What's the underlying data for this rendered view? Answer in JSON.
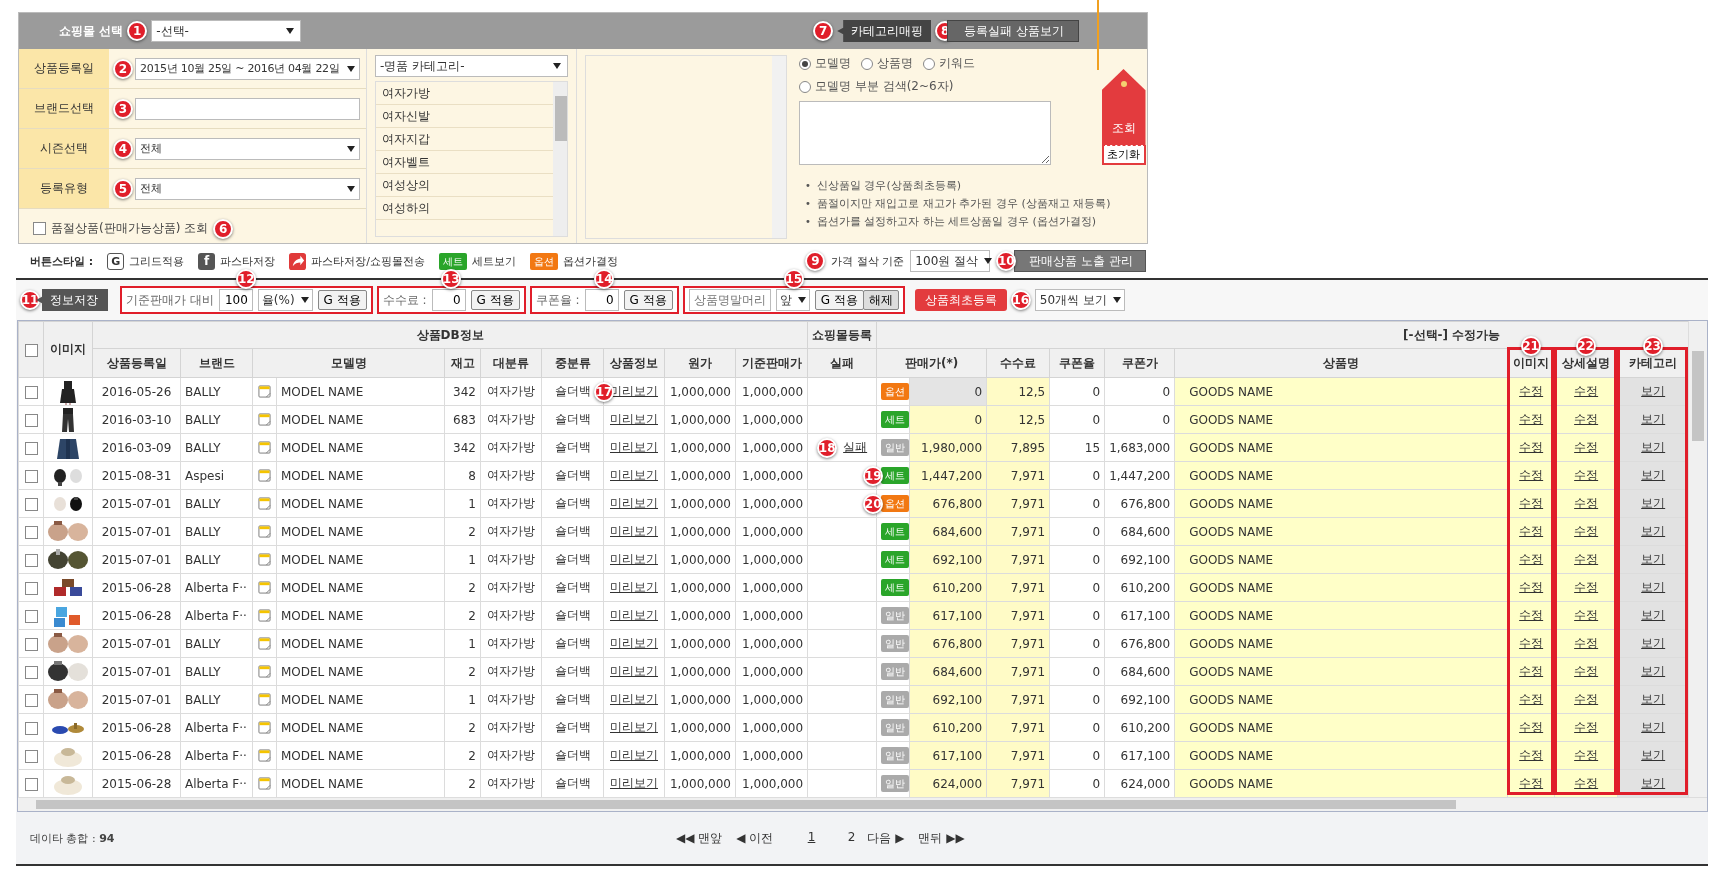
{
  "top_panel": {
    "shop_select": {
      "label": "쇼핑몰 선택",
      "marker": "1",
      "value": "-선택-"
    },
    "header_buttons": [
      {
        "marker": "7",
        "label": "카테고리매핑",
        "kind": "dark"
      },
      {
        "marker": "8",
        "label": "등록실패 상품보기",
        "kind": "grey"
      }
    ],
    "fields": [
      {
        "kind": "select",
        "label": "상품등록일",
        "marker": "2",
        "value": "2015년 10월 25일 ~ 2016년 04월 22일"
      },
      {
        "kind": "input",
        "label": "브랜드선택",
        "marker": "3"
      },
      {
        "kind": "select",
        "label": "시즌선택",
        "marker": "4",
        "value": "전체"
      },
      {
        "kind": "select",
        "label": "등록유형",
        "marker": "5",
        "value": "전체"
      }
    ],
    "soldout_check": {
      "label": "품절상품(판매가능상품) 조회",
      "checked": false,
      "marker": "6"
    },
    "category": {
      "value": "-명품 카테고리-",
      "items": [
        "여자가방",
        "여자신발",
        "여자지갑",
        "여자벨트",
        "여성상의",
        "여성하의"
      ]
    },
    "search_options": [
      {
        "label": "모델명",
        "selected": true
      },
      {
        "label": "상품명",
        "selected": false
      },
      {
        "label": "키워드",
        "selected": false
      },
      {
        "label": "모델명 부분 검색(2~6자)",
        "selected": false
      }
    ],
    "note_bullet": "•",
    "notes": [
      "신상품일 경우(상품최초등록)",
      "품절이지만 재입고로 재고가 추가된 경우 (상품재고 재등록)",
      "옵션가를 설정하고자 하는 세트상품일 경우 (옵션가결정)"
    ],
    "search_tag": {
      "label": "조회",
      "reset": "초기화"
    }
  },
  "button_styles": {
    "label": "버튼스타일 :",
    "items": [
      {
        "kind": "grid",
        "icon": "G",
        "label": "그리드적용"
      },
      {
        "kind": "save",
        "icon": "f",
        "label": "파스타저장"
      },
      {
        "kind": "send",
        "label": "파스타저장/쇼핑몰전송"
      },
      {
        "kind": "set",
        "icon": "세트",
        "label": "세트보기"
      },
      {
        "kind": "option",
        "icon": "옵션",
        "label": "옵션가결정"
      }
    ],
    "rounding": {
      "marker": "9",
      "label": "가격 절삭 기준",
      "value": "100원 절삭"
    },
    "exposure_button": {
      "marker": "10",
      "label": "판매상품 노출 관리"
    }
  },
  "toolbar": {
    "save_button": {
      "marker": "11",
      "label": "정보저장"
    },
    "groups": [
      {
        "marker": "12",
        "label": "기준판매가 대비",
        "value": "100",
        "unit": "율(%)",
        "apply": "G 적용"
      },
      {
        "marker": "13",
        "label": "수수료 :",
        "value": "0",
        "apply": "G 적용"
      },
      {
        "marker": "14",
        "label": "쿠폰율 :",
        "value": "0",
        "apply": "G 적용"
      },
      {
        "marker": "15",
        "placeholder": "상품명말머리",
        "unit": "앞",
        "apply": "G 적용",
        "clear": "해제"
      }
    ],
    "register_button": {
      "label": "상품최초등록",
      "marker": "16"
    },
    "page_size": "50개씩 보기"
  },
  "table": {
    "select_all": {
      "checked": false
    },
    "group_headers": [
      "상품DB정보",
      "쇼핑몰등록",
      "[-선택-] 수정가능"
    ],
    "columns": [
      {
        "label": "이미지"
      },
      {
        "label": "상품등록일"
      },
      {
        "label": "브랜드"
      },
      {
        "label": "모델명"
      },
      {
        "label": "재고"
      },
      {
        "label": "대분류"
      },
      {
        "label": "중분류"
      },
      {
        "label": "상품정보"
      },
      {
        "label": "원가"
      },
      {
        "label": "기준판매가"
      },
      {
        "label": "실패"
      },
      {
        "label": "판매가(*)"
      },
      {
        "label": "수수료"
      },
      {
        "label": "쿠폰율"
      },
      {
        "label": "쿠폰가"
      },
      {
        "label": "상품명"
      },
      {
        "label": "이미지",
        "marker": "21"
      },
      {
        "label": "상세설명",
        "marker": "22"
      },
      {
        "label": "카테고리",
        "marker": "23"
      }
    ],
    "rows": [
      {
        "checked": false,
        "date": "2016-05-26",
        "brand": "BALLY",
        "model": "MODEL NAME",
        "stock": "342",
        "cat1": "여자가방",
        "cat2": "숄더백",
        "info": "미리보기",
        "cost": "1,000,000",
        "base": "1,000,000",
        "badge": {
          "kind": "option",
          "label": "옵션"
        },
        "price": "0",
        "price_disabled": true,
        "fee": "12,5",
        "coupon_rate": "0",
        "coupon_price": "0",
        "name": "GOODS NAME",
        "image_edit": "수정",
        "desc_edit": "수정",
        "category_view": "보기",
        "info_marker": "17"
      },
      {
        "checked": false,
        "date": "2016-03-10",
        "brand": "BALLY",
        "model": "MODEL NAME",
        "stock": "683",
        "cat1": "여자가방",
        "cat2": "숄더백",
        "info": "미리보기",
        "cost": "1,000,000",
        "base": "1,000,000",
        "badge": {
          "kind": "set",
          "label": "세트"
        },
        "price": "0",
        "price_disabled": false,
        "fee": "12,5",
        "coupon_rate": "0",
        "coupon_price": "0",
        "name": "GOODS NAME",
        "image_edit": "수정",
        "desc_edit": "수정",
        "category_view": "보기"
      },
      {
        "checked": false,
        "date": "2016-03-09",
        "brand": "BALLY",
        "model": "MODEL NAME",
        "stock": "342",
        "cat1": "여자가방",
        "cat2": "숄더백",
        "info": "미리보기",
        "cost": "1,000,000",
        "base": "1,000,000",
        "fail": "실패",
        "badge": {
          "kind": "normal",
          "label": "일반"
        },
        "price": "1,980,000",
        "price_disabled": false,
        "fee": "7,895",
        "coupon_rate": "15",
        "coupon_price": "1,683,000",
        "name": "GOODS NAME",
        "image_edit": "수정",
        "desc_edit": "수정",
        "category_view": "보기",
        "fail_marker": "18"
      },
      {
        "checked": false,
        "date": "2015-08-31",
        "brand": "Aspesi",
        "model": "MODEL NAME",
        "stock": "8",
        "cat1": "여자가방",
        "cat2": "숄더백",
        "info": "미리보기",
        "cost": "1,000,000",
        "base": "1,000,000",
        "badge": {
          "kind": "set",
          "label": "세트"
        },
        "price": "1,447,200",
        "price_disabled": false,
        "fee": "7,971",
        "coupon_rate": "0",
        "coupon_price": "1,447,200",
        "name": "GOODS NAME",
        "image_edit": "수정",
        "desc_edit": "수정",
        "category_view": "보기",
        "badge_marker": "19"
      },
      {
        "checked": false,
        "date": "2015-07-01",
        "brand": "BALLY",
        "model": "MODEL NAME",
        "stock": "1",
        "cat1": "여자가방",
        "cat2": "숄더백",
        "info": "미리보기",
        "cost": "1,000,000",
        "base": "1,000,000",
        "badge": {
          "kind": "option",
          "label": "옵션"
        },
        "price": "676,800",
        "price_disabled": false,
        "fee": "7,971",
        "coupon_rate": "0",
        "coupon_price": "676,800",
        "name": "GOODS NAME",
        "image_edit": "수정",
        "desc_edit": "수정",
        "category_view": "보기",
        "badge_marker": "20"
      },
      {
        "checked": false,
        "date": "2015-07-01",
        "brand": "BALLY",
        "model": "MODEL NAME",
        "stock": "2",
        "cat1": "여자가방",
        "cat2": "숄더백",
        "info": "미리보기",
        "cost": "1,000,000",
        "base": "1,000,000",
        "badge": {
          "kind": "set",
          "label": "세트"
        },
        "price": "684,600",
        "price_disabled": false,
        "fee": "7,971",
        "coupon_rate": "0",
        "coupon_price": "684,600",
        "name": "GOODS NAME",
        "image_edit": "수정",
        "desc_edit": "수정",
        "category_view": "보기"
      },
      {
        "checked": false,
        "date": "2015-07-01",
        "brand": "BALLY",
        "model": "MODEL NAME",
        "stock": "1",
        "cat1": "여자가방",
        "cat2": "숄더백",
        "info": "미리보기",
        "cost": "1,000,000",
        "base": "1,000,000",
        "badge": {
          "kind": "set",
          "label": "세트"
        },
        "price": "692,100",
        "price_disabled": false,
        "fee": "7,971",
        "coupon_rate": "0",
        "coupon_price": "692,100",
        "name": "GOODS NAME",
        "image_edit": "수정",
        "desc_edit": "수정",
        "category_view": "보기"
      },
      {
        "checked": false,
        "date": "2015-06-28",
        "brand": "Alberta F··",
        "model": "MODEL NAME",
        "stock": "2",
        "cat1": "여자가방",
        "cat2": "숄더백",
        "info": "미리보기",
        "cost": "1,000,000",
        "base": "1,000,000",
        "badge": {
          "kind": "set",
          "label": "세트"
        },
        "price": "610,200",
        "price_disabled": false,
        "fee": "7,971",
        "coupon_rate": "0",
        "coupon_price": "610,200",
        "name": "GOODS NAME",
        "image_edit": "수정",
        "desc_edit": "수정",
        "category_view": "보기"
      },
      {
        "checked": false,
        "date": "2015-06-28",
        "brand": "Alberta F··",
        "model": "MODEL NAME",
        "stock": "2",
        "cat1": "여자가방",
        "cat2": "숄더백",
        "info": "미리보기",
        "cost": "1,000,000",
        "base": "1,000,000",
        "badge": {
          "kind": "normal",
          "label": "일반"
        },
        "price": "617,100",
        "price_disabled": false,
        "fee": "7,971",
        "coupon_rate": "0",
        "coupon_price": "617,100",
        "name": "GOODS NAME",
        "image_edit": "수정",
        "desc_edit": "수정",
        "category_view": "보기"
      },
      {
        "checked": false,
        "date": "2015-07-01",
        "brand": "BALLY",
        "model": "MODEL NAME",
        "stock": "1",
        "cat1": "여자가방",
        "cat2": "숄더백",
        "info": "미리보기",
        "cost": "1,000,000",
        "base": "1,000,000",
        "badge": {
          "kind": "normal",
          "label": "일반"
        },
        "price": "676,800",
        "price_disabled": false,
        "fee": "7,971",
        "coupon_rate": "0",
        "coupon_price": "676,800",
        "name": "GOODS NAME",
        "image_edit": "수정",
        "desc_edit": "수정",
        "category_view": "보기"
      },
      {
        "checked": false,
        "date": "2015-07-01",
        "brand": "BALLY",
        "model": "MODEL NAME",
        "stock": "2",
        "cat1": "여자가방",
        "cat2": "숄더백",
        "info": "미리보기",
        "cost": "1,000,000",
        "base": "1,000,000",
        "badge": {
          "kind": "normal",
          "label": "일반"
        },
        "price": "684,600",
        "price_disabled": false,
        "fee": "7,971",
        "coupon_rate": "0",
        "coupon_price": "684,600",
        "name": "GOODS NAME",
        "image_edit": "수정",
        "desc_edit": "수정",
        "category_view": "보기"
      },
      {
        "checked": false,
        "date": "2015-07-01",
        "brand": "BALLY",
        "model": "MODEL NAME",
        "stock": "1",
        "cat1": "여자가방",
        "cat2": "숄더백",
        "info": "미리보기",
        "cost": "1,000,000",
        "base": "1,000,000",
        "badge": {
          "kind": "normal",
          "label": "일반"
        },
        "price": "692,100",
        "price_disabled": false,
        "fee": "7,971",
        "coupon_rate": "0",
        "coupon_price": "692,100",
        "name": "GOODS NAME",
        "image_edit": "수정",
        "desc_edit": "수정",
        "category_view": "보기"
      },
      {
        "checked": false,
        "date": "2015-06-28",
        "brand": "Alberta F··",
        "model": "MODEL NAME",
        "stock": "2",
        "cat1": "여자가방",
        "cat2": "숄더백",
        "info": "미리보기",
        "cost": "1,000,000",
        "base": "1,000,000",
        "badge": {
          "kind": "normal",
          "label": "일반"
        },
        "price": "610,200",
        "price_disabled": false,
        "fee": "7,971",
        "coupon_rate": "0",
        "coupon_price": "610,200",
        "name": "GOODS NAME",
        "image_edit": "수정",
        "desc_edit": "수정",
        "category_view": "보기"
      },
      {
        "checked": false,
        "date": "2015-06-28",
        "brand": "Alberta F··",
        "model": "MODEL NAME",
        "stock": "2",
        "cat1": "여자가방",
        "cat2": "숄더백",
        "info": "미리보기",
        "cost": "1,000,000",
        "base": "1,000,000",
        "badge": {
          "kind": "normal",
          "label": "일반"
        },
        "price": "617,100",
        "price_disabled": false,
        "fee": "7,971",
        "coupon_rate": "0",
        "coupon_price": "617,100",
        "name": "GOODS NAME",
        "image_edit": "수정",
        "desc_edit": "수정",
        "category_view": "보기"
      },
      {
        "checked": false,
        "date": "2015-06-28",
        "brand": "Alberta F··",
        "model": "MODEL NAME",
        "stock": "2",
        "cat1": "여자가방",
        "cat2": "숄더백",
        "info": "미리보기",
        "cost": "1,000,000",
        "base": "1,000,000",
        "badge": {
          "kind": "normal",
          "label": "일반"
        },
        "price": "624,000",
        "price_disabled": false,
        "fee": "7,971",
        "coupon_rate": "0",
        "coupon_price": "624,000",
        "name": "GOODS NAME",
        "image_edit": "수정",
        "desc_edit": "수정",
        "category_view": "보기"
      }
    ]
  },
  "footer": {
    "total": "데이타 총합 : **94**",
    "first": "◀◀ 맨앞",
    "prev": "◀ 이전",
    "pages": [
      {
        "label": "1",
        "selected": true
      },
      {
        "label": "2",
        "selected": false
      }
    ],
    "next": "다음 ▶",
    "last": "맨뒤 ▶▶"
  }
}
